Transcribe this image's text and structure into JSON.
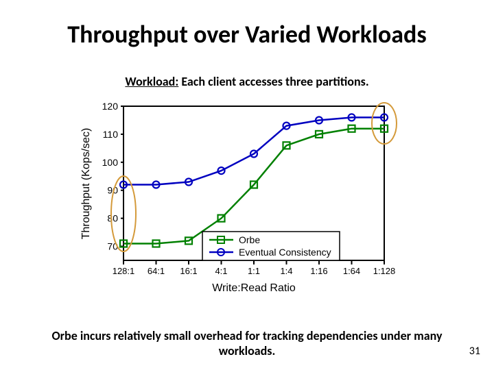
{
  "title": "Throughput over Varied Workloads",
  "subtitle_label": "Workload:",
  "subtitle_rest": " Each client accesses three partitions.",
  "caption": "Orbe incurs relatively small overhead for tracking dependencies under many workloads.",
  "page_number": "31",
  "chart_data": {
    "type": "line",
    "xlabel": "Write:Read Ratio",
    "ylabel": "Throughput (Kops/sec)",
    "ylim": [
      65,
      120
    ],
    "yticks": [
      70,
      80,
      90,
      100,
      110,
      120
    ],
    "categories": [
      "128:1",
      "64:1",
      "16:1",
      "4:1",
      "1:1",
      "1:4",
      "1:16",
      "1:64",
      "1:128"
    ],
    "series": [
      {
        "name": "Orbe",
        "color": "#008000",
        "marker": "square",
        "values": [
          71,
          71,
          72,
          80,
          92,
          106,
          110,
          112,
          112
        ]
      },
      {
        "name": "Eventual Consistency",
        "color": "#0000c0",
        "marker": "circle",
        "values": [
          92,
          92,
          93,
          97,
          103,
          113,
          115,
          116,
          116
        ]
      }
    ],
    "annotations": [
      {
        "type": "ellipse",
        "x_index": 0,
        "y": 81
      },
      {
        "type": "ellipse",
        "x_index": 8,
        "y": 114
      }
    ]
  },
  "legend": {
    "orbe": "Orbe",
    "ec": "Eventual Consistency"
  },
  "axis": {
    "ylabel": "Throughput (Kops/sec)",
    "xlabel": "Write:Read Ratio",
    "yt70": "70",
    "yt80": "80",
    "yt90": "90",
    "yt100": "100",
    "yt110": "110",
    "yt120": "120",
    "xt0": "128:1",
    "xt1": "64:1",
    "xt2": "16:1",
    "xt3": "4:1",
    "xt4": "1:1",
    "xt5": "1:4",
    "xt6": "1:16",
    "xt7": "1:64",
    "xt8": "1:128"
  }
}
